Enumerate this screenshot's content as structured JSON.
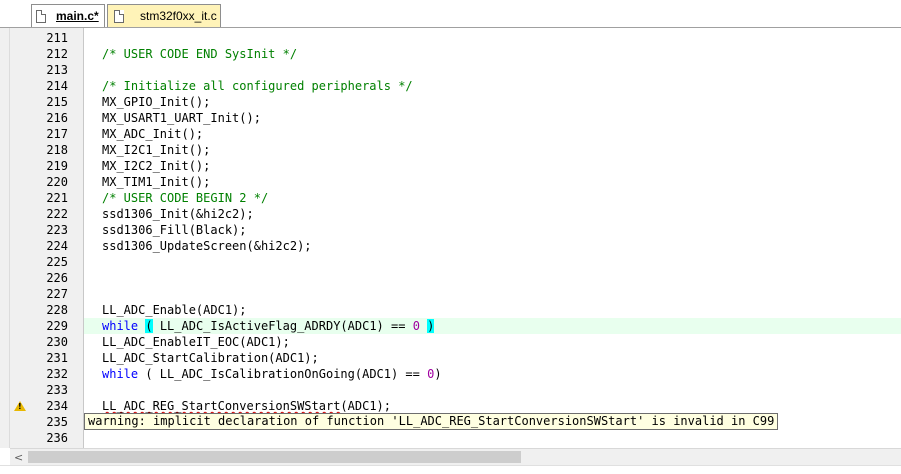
{
  "tabs": [
    {
      "label": "main.c*",
      "active": true
    },
    {
      "label": "stm32f0xx_it.c",
      "active": false
    }
  ],
  "lines": [
    {
      "num": "211",
      "code": ""
    },
    {
      "num": "212",
      "code": "/* USER CODE END SysInit */"
    },
    {
      "num": "213",
      "code": ""
    },
    {
      "num": "214",
      "code": "/* Initialize all configured peripherals */"
    },
    {
      "num": "215",
      "code": "MX_GPIO_Init();"
    },
    {
      "num": "216",
      "code": "MX_USART1_UART_Init();"
    },
    {
      "num": "217",
      "code": "MX_ADC_Init();"
    },
    {
      "num": "218",
      "code": "MX_I2C1_Init();"
    },
    {
      "num": "219",
      "code": "MX_I2C2_Init();"
    },
    {
      "num": "220",
      "code": "MX_TIM1_Init();"
    },
    {
      "num": "221",
      "code": "/* USER CODE BEGIN 2 */"
    },
    {
      "num": "222",
      "code": "ssd1306_Init(&hi2c2);"
    },
    {
      "num": "223",
      "code": "ssd1306_Fill(Black);"
    },
    {
      "num": "224",
      "code": "ssd1306_UpdateScreen(&hi2c2);"
    },
    {
      "num": "225",
      "code": ""
    },
    {
      "num": "226",
      "code": ""
    },
    {
      "num": "227",
      "code": ""
    },
    {
      "num": "228",
      "code": "LL_ADC_Enable(ADC1);"
    },
    {
      "num": "229",
      "code": "while ( LL_ADC_IsActiveFlag_ADRDY(ADC1) == 0 )"
    },
    {
      "num": "230",
      "code": "LL_ADC_EnableIT_EOC(ADC1);"
    },
    {
      "num": "231",
      "code": "LL_ADC_StartCalibration(ADC1);"
    },
    {
      "num": "232",
      "code": "while ( LL_ADC_IsCalibrationOnGoing(ADC1) == 0)"
    },
    {
      "num": "233",
      "code": ""
    },
    {
      "num": "234",
      "code": "LL_ADC_REG_StartConversionSWStart(ADC1);"
    },
    {
      "num": "235",
      "code": ""
    },
    {
      "num": "236",
      "code": ""
    }
  ],
  "tooltip": "warning: implicit declaration of function 'LL_ADC_REG_StartConversionSWStart' is invalid in C99",
  "colors": {
    "comment": "#008000",
    "keyword": "#0000ff",
    "number": "#a000a0",
    "current_line": "#e8ffee",
    "brace_match": "#00ffff",
    "inactive_tab": "#fff3b8",
    "tooltip_bg": "#ffffe1"
  },
  "icons": {
    "tab_file": "file-icon",
    "warning": "warning-icon",
    "scroll_left": "scroll-left-arrow-icon"
  },
  "warning_line": "234",
  "highlight_line": "229",
  "scroll_left_arrow": "<"
}
